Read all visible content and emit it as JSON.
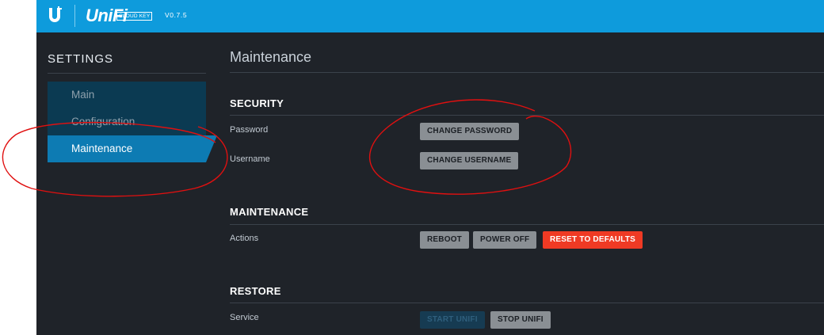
{
  "header": {
    "logo_icon": "ubiquiti-u-icon",
    "logo_letter": "U",
    "brand": "UniFi",
    "brand_badge": "CLOUD KEY",
    "version": "V0.7.5",
    "bar_color": "#0e9bdc"
  },
  "sidebar": {
    "title": "SETTINGS",
    "items": [
      {
        "label": "Main",
        "active": false
      },
      {
        "label": "Configuration",
        "active": false
      },
      {
        "label": "Maintenance",
        "active": true
      }
    ],
    "active_color": "#0d7bb3"
  },
  "main": {
    "title": "Maintenance",
    "sections": {
      "security": {
        "title": "SECURITY",
        "password_label": "Password",
        "change_password_button": "CHANGE PASSWORD",
        "username_label": "Username",
        "change_username_button": "CHANGE USERNAME"
      },
      "maintenance": {
        "title": "MAINTENANCE",
        "actions_label": "Actions",
        "reboot_button": "REBOOT",
        "power_off_button": "POWER OFF",
        "reset_button": "RESET TO DEFAULTS"
      },
      "restore": {
        "title": "RESTORE",
        "service_label": "Service",
        "start_button": "START UNIFI",
        "stop_button": "STOP UNIFI"
      }
    }
  },
  "annotation": {
    "color": "#e01010",
    "shape": "hand-drawn-ellipse"
  }
}
